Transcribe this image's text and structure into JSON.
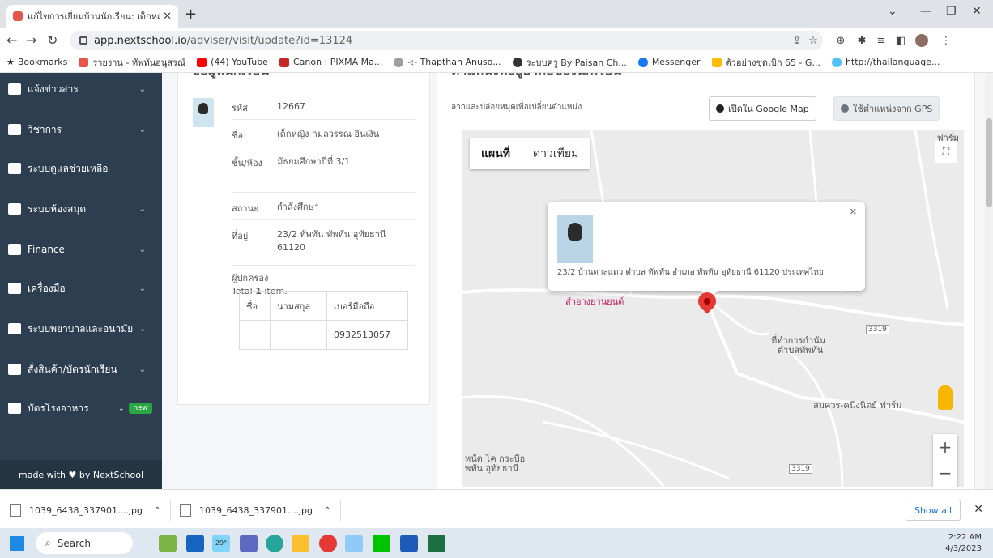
{
  "browser": {
    "tab_title": "แก้ไขการเยี่ยมบ้านนักเรียน: เด็กหญิง ก...",
    "url_host": "app.nextschool.io",
    "url_path": "/adviser/visit/update?id=13124",
    "bookmarks": [
      {
        "label": "Bookmarks",
        "color": "#333333"
      },
      {
        "label": "รายงาน - ทัพทันอนุสรณ์",
        "color": "#e2564b"
      },
      {
        "label": "(44) YouTube",
        "color": "#ff0000"
      },
      {
        "label": "Canon : PIXMA Ma...",
        "color": "#c62828"
      },
      {
        "label": "-:- Thapthan Anuso...",
        "color": "#9e9e9e"
      },
      {
        "label": "ระบบครู By Paisan Ch...",
        "color": "#333333"
      },
      {
        "label": "Messenger",
        "color": "#1877f2"
      },
      {
        "label": "ตัวอย่างชุดเบิก 65 - G...",
        "color": "#fbbc04"
      },
      {
        "label": "http://thailanguage...",
        "color": "#4fc3f7"
      }
    ]
  },
  "sidebar": {
    "items": [
      {
        "label": "แจ้งข่าวสาร"
      },
      {
        "label": "วิชาการ"
      },
      {
        "label": "ระบบดูแลช่วยเหลือ"
      },
      {
        "label": "ระบบห้องสมุด"
      },
      {
        "label": "Finance"
      },
      {
        "label": "เครื่องมือ"
      },
      {
        "label": "ระบบพยาบาลและอนามัย"
      },
      {
        "label": "สั่งสินค้า/บัตรนักเรียน"
      },
      {
        "label": "บัตรโรงอาหาร",
        "badge": "new"
      }
    ],
    "footer": "made with ♥ by NextSchool"
  },
  "student_card": {
    "title": "ข้อมูลนักเรียน",
    "rows": [
      {
        "key": "รหัส",
        "value": "12667"
      },
      {
        "key": "ชื่อ",
        "value": "เด็กหญิง กมลวรรณ อินเงิน"
      },
      {
        "key": "ชั้น/ห้อง",
        "value": "มัธยมศึกษาปีที่ 3/1"
      },
      {
        "key": "สถานะ",
        "value": "กำลังศึกษา"
      },
      {
        "key": "ที่อยู่",
        "value": "23/2 ทัพทัน ทัพทัน อุทัยธานี 61120"
      }
    ],
    "guardian_label": "ผู้ปกครอง",
    "total_prefix": "Total ",
    "total_count": "1",
    "total_suffix": " item.",
    "table_headers": [
      "ชื่อ",
      "นามสกุล",
      "เบอร์มือถือ"
    ],
    "table_rows": [
      [
        "",
        "",
        "0932513057"
      ]
    ]
  },
  "map_card": {
    "title": "ตำแหน่งที่อยู่อาศัยของนักเรียน",
    "hint": "ลากและปล่อยหมุดเพื่อเปลี่ยนตำแหน่ง",
    "open_google_map": "เปิดใน Google Map",
    "use_gps": "ใช้ตำแหน่งจาก GPS",
    "map_type_map": "แผนที่",
    "map_type_satellite": "ดาวเทียม",
    "popup_address": "23/2 บ้านดาลแดว ตำบล ทัพทัน อำเภอ ทัพทัน อุทัยธานี 61120 ประเทศไทย",
    "labels": {
      "place_red": "สำอางยานยนต์",
      "office": "ที่ทำการกำนัน",
      "office2": "ตำบลทัพทัน",
      "farm": "สมควร-คนึงนิตย์ ฟาร์ม",
      "farm_top": "ฟาร์ม",
      "temple1": "หนัด โค กระบือ",
      "temple2": "พทัน อุทัยธานี",
      "road1": "3319",
      "road2": "3319"
    }
  },
  "downloads": {
    "items": [
      "1039_6438_337901....jpg",
      "1039_6438_337901....jpg"
    ],
    "show_all": "Show all"
  },
  "taskbar": {
    "search": "Search",
    "temp": "29°",
    "time": "2:22 AM",
    "date": "4/3/2023"
  }
}
